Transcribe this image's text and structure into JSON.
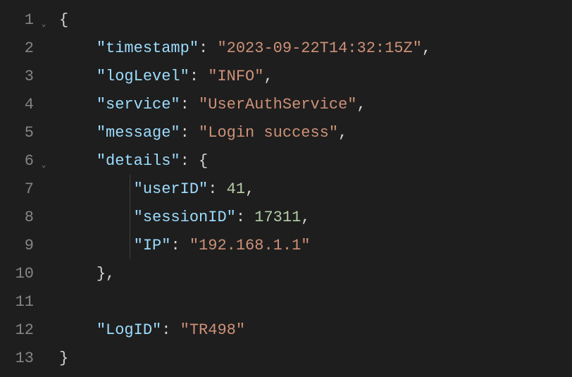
{
  "lines": [
    {
      "num": "1",
      "fold": true
    },
    {
      "num": "2",
      "fold": false
    },
    {
      "num": "3",
      "fold": false
    },
    {
      "num": "4",
      "fold": false
    },
    {
      "num": "5",
      "fold": false
    },
    {
      "num": "6",
      "fold": true
    },
    {
      "num": "7",
      "fold": false
    },
    {
      "num": "8",
      "fold": false
    },
    {
      "num": "9",
      "fold": false
    },
    {
      "num": "10",
      "fold": false
    },
    {
      "num": "11",
      "fold": false
    },
    {
      "num": "12",
      "fold": false
    },
    {
      "num": "13",
      "fold": false
    }
  ],
  "json_content": {
    "keys": {
      "timestamp": "\"timestamp\"",
      "logLevel": "\"logLevel\"",
      "service": "\"service\"",
      "message": "\"message\"",
      "details": "\"details\"",
      "userID": "\"userID\"",
      "sessionID": "\"sessionID\"",
      "IP": "\"IP\"",
      "LogID": "\"LogID\""
    },
    "values": {
      "timestamp": "\"2023-09-22T14:32:15Z\"",
      "logLevel": "\"INFO\"",
      "service": "\"UserAuthService\"",
      "message": "\"Login success\"",
      "userID": "41",
      "sessionID": "17311",
      "IP": "\"192.168.1.1\"",
      "LogID": "\"TR498\""
    },
    "punctuation": {
      "open_brace": "{",
      "close_brace": "}",
      "colon": ":",
      "comma": ","
    },
    "indent1": "    ",
    "indent2": "        "
  },
  "fold_glyph": "⌄"
}
